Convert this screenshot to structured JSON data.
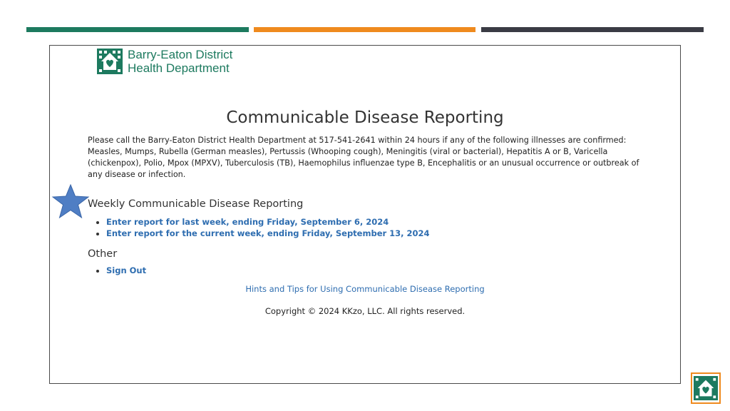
{
  "decor": {
    "colors": {
      "green": "#1d7a5f",
      "orange": "#ef8a1e",
      "dark": "#3a3b44",
      "link": "#2e6db0",
      "star": "#4f7ec4"
    }
  },
  "header": {
    "org_line1": "Barry-Eaton District",
    "org_line2": "Health Department",
    "logo_icon": "house-heart-icon"
  },
  "main": {
    "title": "Communicable Disease Reporting",
    "intro_line1": "Please call the Barry-Eaton District Health Department at 517-541-2641 within 24 hours if any of the following illnesses are confirmed:",
    "intro_line2": "Measles, Mumps, Rubella (German measles), Pertussis (Whooping cough), Meningitis (viral or bacterial), Hepatitis A or B, Varicella (chickenpox), Polio, Mpox (MPXV), Tuberculosis (TB), Haemophilus influenzae type B, Encephalitis or an unusual occurrence or outbreak of any disease or infection.",
    "weekly": {
      "heading": "Weekly Communicable Disease Reporting",
      "links": [
        "Enter report for last week, ending Friday, September 6, 2024",
        "Enter report for the current week, ending Friday, September 13, 2024"
      ]
    },
    "other": {
      "heading": "Other",
      "links": [
        "Sign Out"
      ]
    },
    "hints_link": "Hints and Tips for Using Communicable Disease Reporting",
    "copyright": "Copyright © 2024 KKzo, LLC.  All rights reserved."
  },
  "annotation": {
    "icon": "star-icon"
  }
}
